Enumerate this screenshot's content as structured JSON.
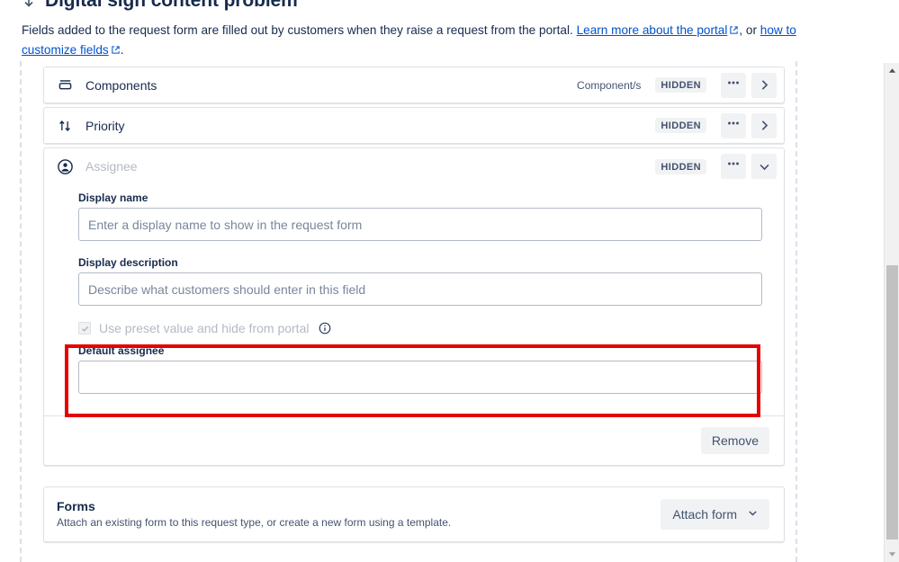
{
  "header": {
    "title": "Digital sign content problem",
    "title_icon": "arrow-down-icon",
    "intro_part_1": "Fields added to the request form are filled out by customers when they raise a request from the portal. ",
    "link_portal": "Learn more about the portal",
    "intro_part_2": ", or ",
    "link_customize": "how to customize fields",
    "intro_part_3": "."
  },
  "fields": [
    {
      "label": "Components",
      "icon": "components-icon",
      "context": "Component/s",
      "badge": "HIDDEN",
      "more_label": "•••",
      "expand_label": "›",
      "expanded": false
    },
    {
      "label": "Priority",
      "icon": "priority-arrows-icon",
      "context": "",
      "badge": "HIDDEN",
      "more_label": "•••",
      "expand_label": "›",
      "expanded": false
    }
  ],
  "assignee": {
    "label": "Assignee",
    "icon": "person-circle-icon",
    "badge": "HIDDEN",
    "more_label": "•••",
    "collapse_label": "⌄",
    "display_name_label": "Display name",
    "display_name_value": "",
    "display_name_placeholder": "Enter a display name to show in the request form",
    "display_description_label": "Display description",
    "display_description_value": "",
    "display_description_placeholder": "Describe what customers should enter in this field",
    "preset_checkbox_label": "Use preset value and hide from portal",
    "preset_checkbox_checked": true,
    "info_icon": "info-icon",
    "default_assignee_label": "Default assignee",
    "default_assignee_value": "",
    "default_assignee_placeholder": "",
    "remove_label": "Remove"
  },
  "forms": {
    "title": "Forms",
    "subtitle": "Attach an existing form to this request type, or create a new form using a template.",
    "attach_label": "Attach form",
    "attach_caret": "⌄"
  },
  "highlight": {
    "color": "#e60000"
  },
  "scrollbar": {
    "up_arrow": "▲",
    "down_arrow": "▼"
  }
}
